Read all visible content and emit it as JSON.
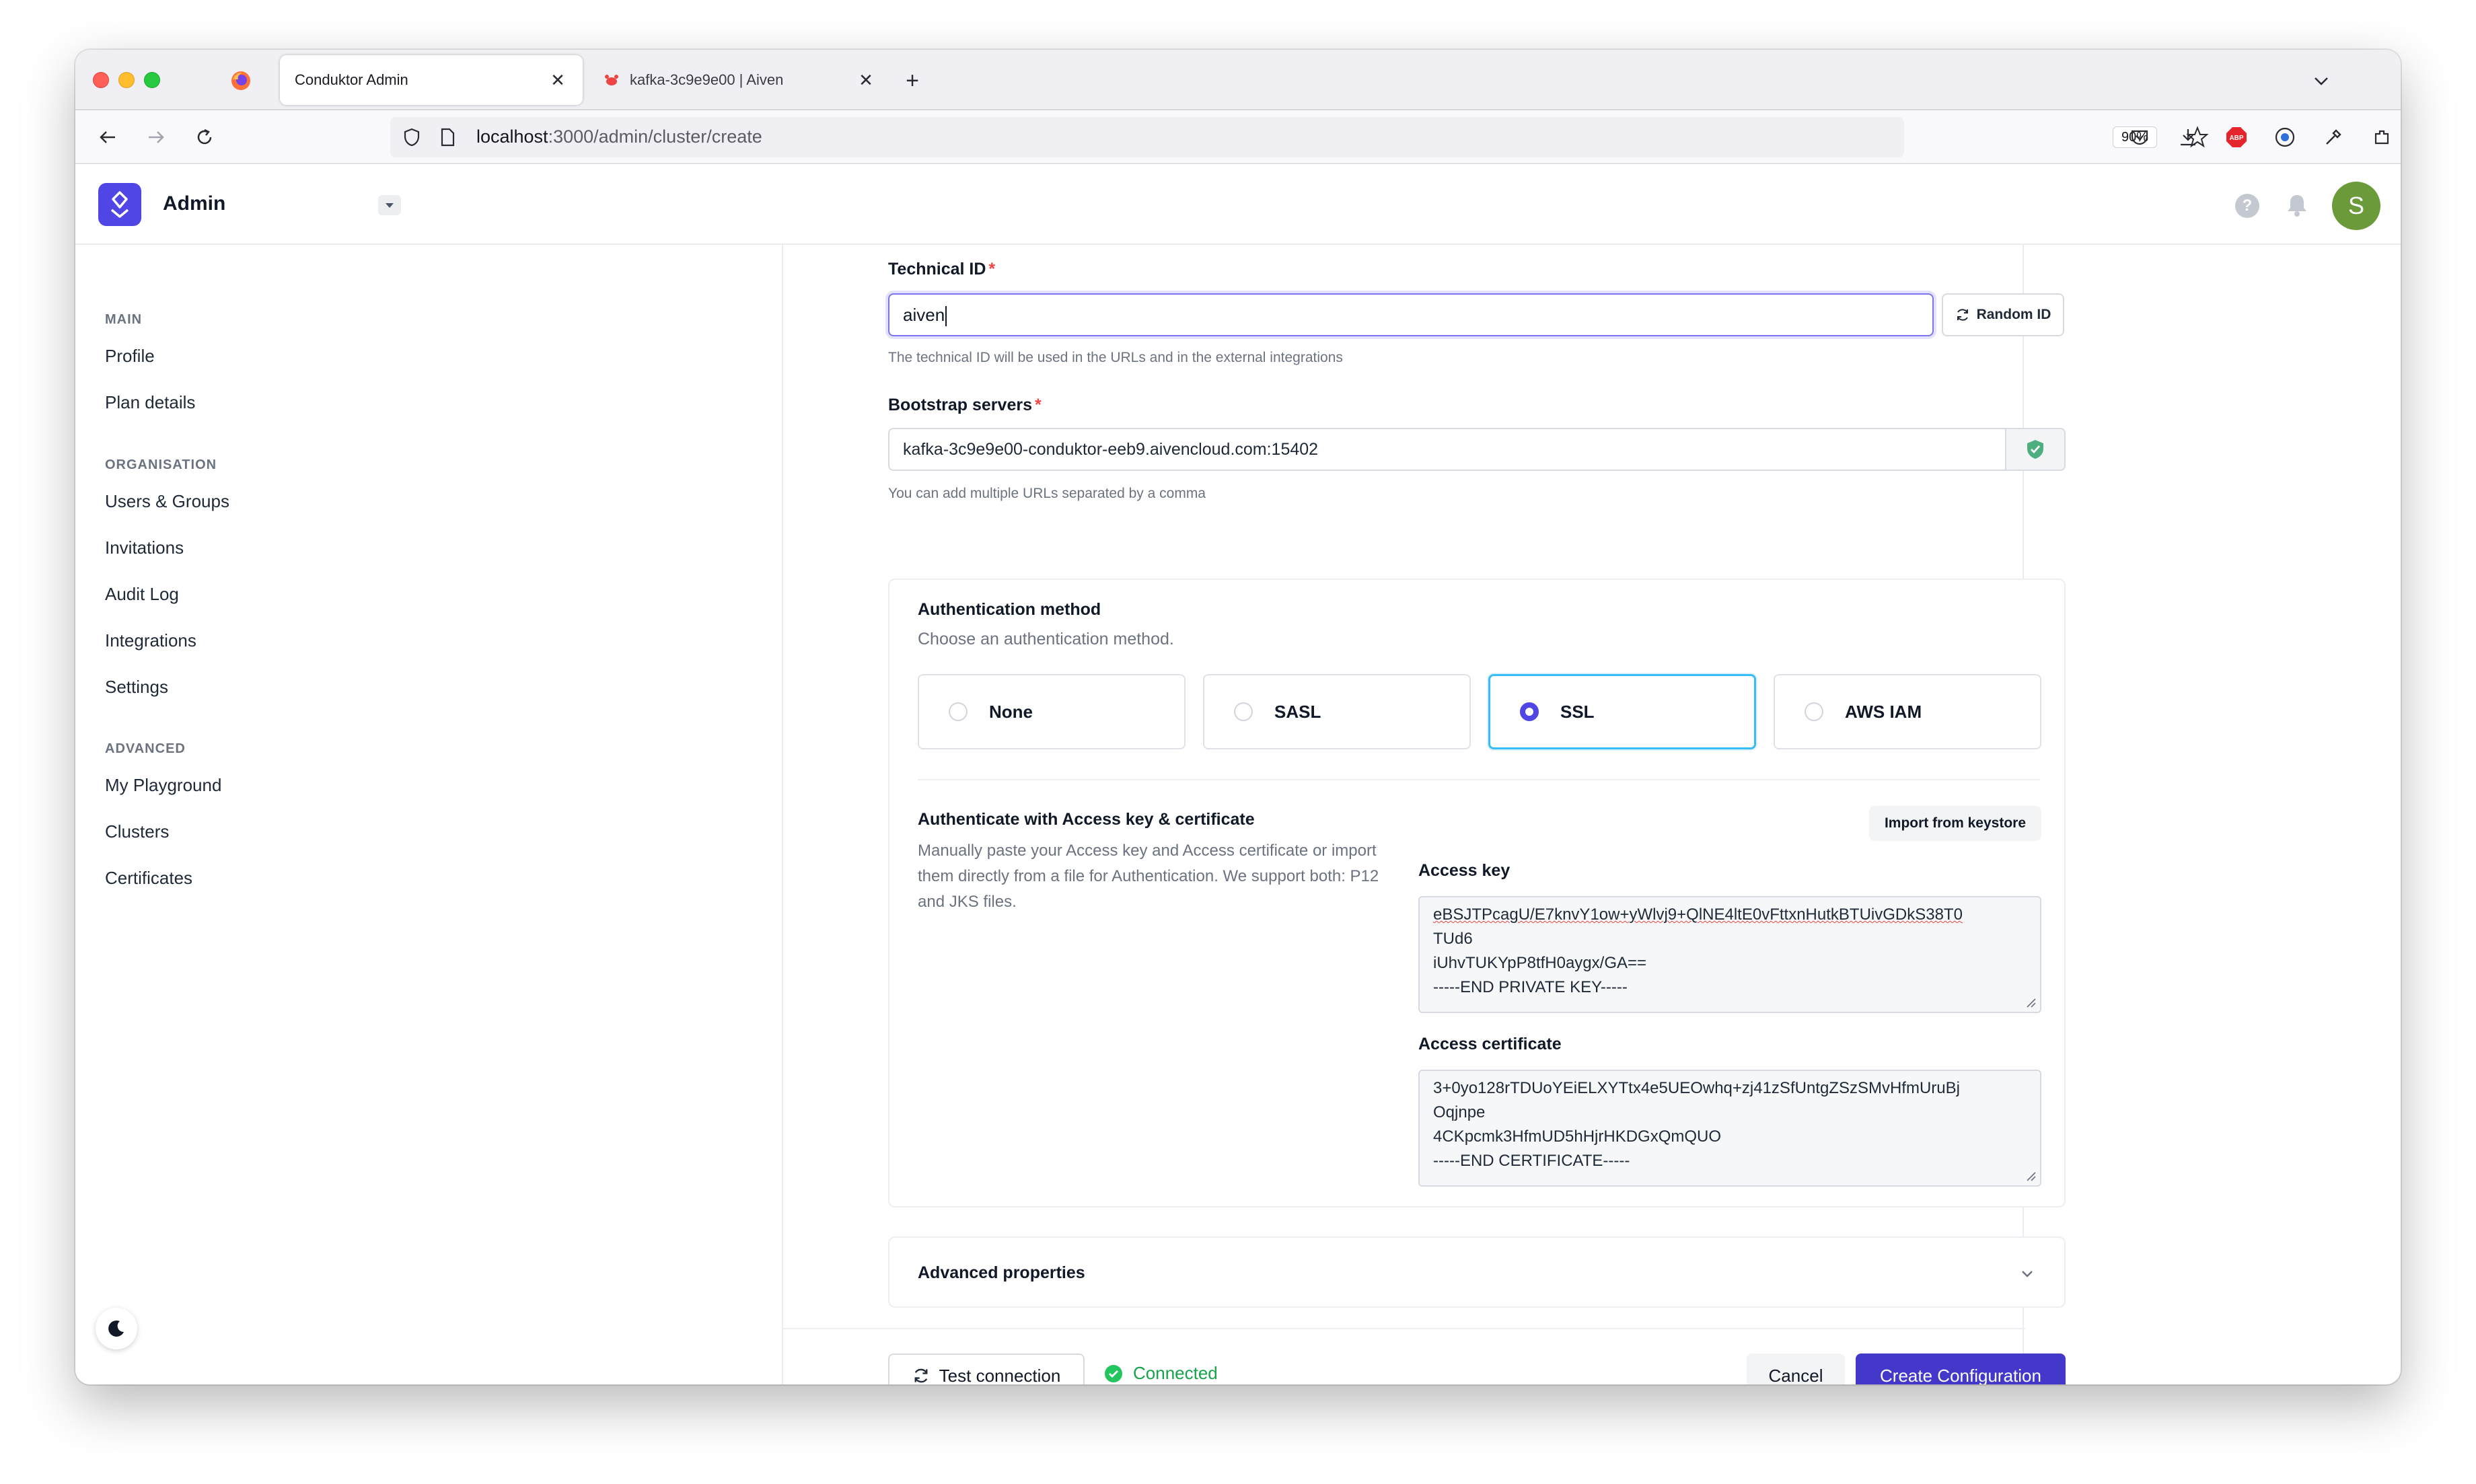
{
  "browser": {
    "tabs": [
      {
        "title": "Conduktor Admin",
        "active": true
      },
      {
        "title": "kafka-3c9e9e00 | Aiven",
        "active": false
      }
    ],
    "url_host": "localhost",
    "url_path": ":3000/admin/cluster/create",
    "zoom": "90%"
  },
  "app": {
    "title": "Admin",
    "avatar_initial": "S",
    "accent_color": "#4f46e5"
  },
  "sidebar": {
    "sections": [
      {
        "title": "MAIN",
        "items": [
          "Profile",
          "Plan details"
        ]
      },
      {
        "title": "ORGANISATION",
        "items": [
          "Users & Groups",
          "Invitations",
          "Audit Log",
          "Integrations",
          "Settings"
        ]
      },
      {
        "title": "ADVANCED",
        "items": [
          "My Playground",
          "Clusters",
          "Certificates"
        ]
      }
    ]
  },
  "form": {
    "technical_id": {
      "label": "Technical ID",
      "required_mark": "*",
      "value": "aiven",
      "helper": "The technical ID will be used in the URLs and in the external integrations",
      "random_button": "Random ID"
    },
    "bootstrap": {
      "label": "Bootstrap servers",
      "required_mark": "*",
      "value": "kafka-3c9e9e00-conduktor-eeb9.aivencloud.com:15402",
      "helper": "You can add multiple URLs separated by a comma"
    },
    "auth": {
      "title": "Authentication method",
      "subtitle": "Choose an authentication method.",
      "options": [
        "None",
        "SASL",
        "SSL",
        "AWS IAM"
      ],
      "selected": "SSL"
    },
    "certificate": {
      "title": "Authenticate with Access key & certificate",
      "description": "Manually paste your Access key and Access certificate or import them directly from a file for Authentication. We support both: P12 and JKS files.",
      "import_button": "Import from keystore",
      "access_key_label": "Access key",
      "access_key_lines": [
        "eBSJTPcagU/E7knvY1ow+yWlvj9+QlNE4ltE0vFttxnHutkBTUivGDkS38T0",
        "TUd6",
        "iUhvTUKYpP8tfH0aygx/GA==",
        "-----END PRIVATE KEY-----"
      ],
      "access_cert_label": "Access certificate",
      "access_cert_lines": [
        "3+0yo128rTDUoYEiELXYTtx4e5UEOwhq+zj41zSfUntgZSzSMvHfmUruBj",
        "Oqjnpe",
        "4CKpcmk3HfmUD5hHjrHKDGxQmQUO",
        "-----END CERTIFICATE-----"
      ]
    },
    "advanced": {
      "title": "Advanced properties"
    }
  },
  "footer": {
    "test_button": "Test connection",
    "status": "Connected",
    "status_color": "#16a34a",
    "cancel_button": "Cancel",
    "create_button": "Create Configuration"
  }
}
